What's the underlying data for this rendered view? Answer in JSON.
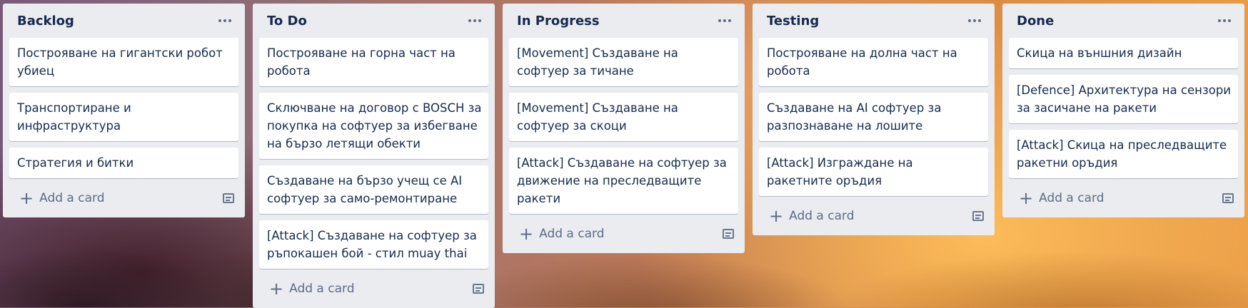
{
  "lists": [
    {
      "title": "Backlog",
      "cards": [
        "Построяване на гигантски робот убиец",
        "Транспортиране и инфраструктура",
        "Стратегия и битки"
      ],
      "add_label": "Add a card"
    },
    {
      "title": "To Do",
      "cards": [
        "Построяване на горна част на робота",
        "Сключване на договор с BOSCH за покупка на софтуер за избегване на бързо летящи обекти",
        "Създаване на бързо учещ се AI софтуер за само-ремонтиране",
        "[Attack] Създаване на софтуер за ръпокашен бой - стил muay thai"
      ],
      "add_label": "Add a card"
    },
    {
      "title": "In Progress",
      "cards": [
        "[Movement] Създаване на софтуер за тичане",
        "[Movement] Създаване на софтуер за скоци",
        "[Attack] Създаване на софтуер за движение на преследващите ракети"
      ],
      "add_label": "Add a card"
    },
    {
      "title": "Testing",
      "cards": [
        "Построяване на долна част на робота",
        "Създаване на AI софтуер за разпознаване на лошите",
        "[Attack] Изграждане на ракетните оръдия"
      ],
      "add_label": "Add a card"
    },
    {
      "title": "Done",
      "cards": [
        "Скица на външния дизайн",
        "[Defence] Архитектура на сензори за засичане на ракети",
        "[Attack] Скица на преследващите ракетни оръдия"
      ],
      "add_label": "Add a card"
    }
  ],
  "icons": {
    "menu": "more-horizontal-icon",
    "add": "plus-icon",
    "template": "card-template-icon"
  },
  "colors": {
    "list_bg": "#ebecf0",
    "card_bg": "#ffffff",
    "text": "#172b4d",
    "muted": "#5e6c84"
  }
}
